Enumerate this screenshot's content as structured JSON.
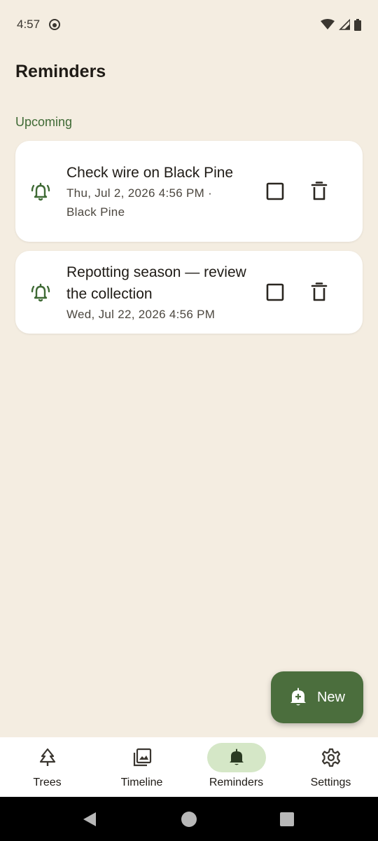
{
  "status_bar": {
    "time": "4:57"
  },
  "header": {
    "title": "Reminders"
  },
  "section": {
    "label": "Upcoming"
  },
  "reminders": [
    {
      "title": "Check wire on Black Pine",
      "subtitle_line1": "Thu, Jul 2, 2026 4:56 PM ·",
      "subtitle_line2": "Black Pine",
      "done": false
    },
    {
      "title": "Repotting season — review the collection",
      "subtitle_line1": "Wed, Jul 22, 2026 4:56 PM",
      "subtitle_line2": "",
      "done": false
    }
  ],
  "fab": {
    "label": "New",
    "icon": "bell-plus-icon"
  },
  "nav": {
    "items": [
      {
        "label": "Trees",
        "icon": "tree-icon",
        "active": false
      },
      {
        "label": "Timeline",
        "icon": "gallery-icon",
        "active": false
      },
      {
        "label": "Reminders",
        "icon": "bell-icon",
        "active": true
      },
      {
        "label": "Settings",
        "icon": "gear-icon",
        "active": false
      }
    ]
  },
  "colors": {
    "background": "#f4ede1",
    "accent": "#4b6e3d",
    "section_label": "#3f6a35",
    "nav_active_pill": "#d5e7c7"
  }
}
